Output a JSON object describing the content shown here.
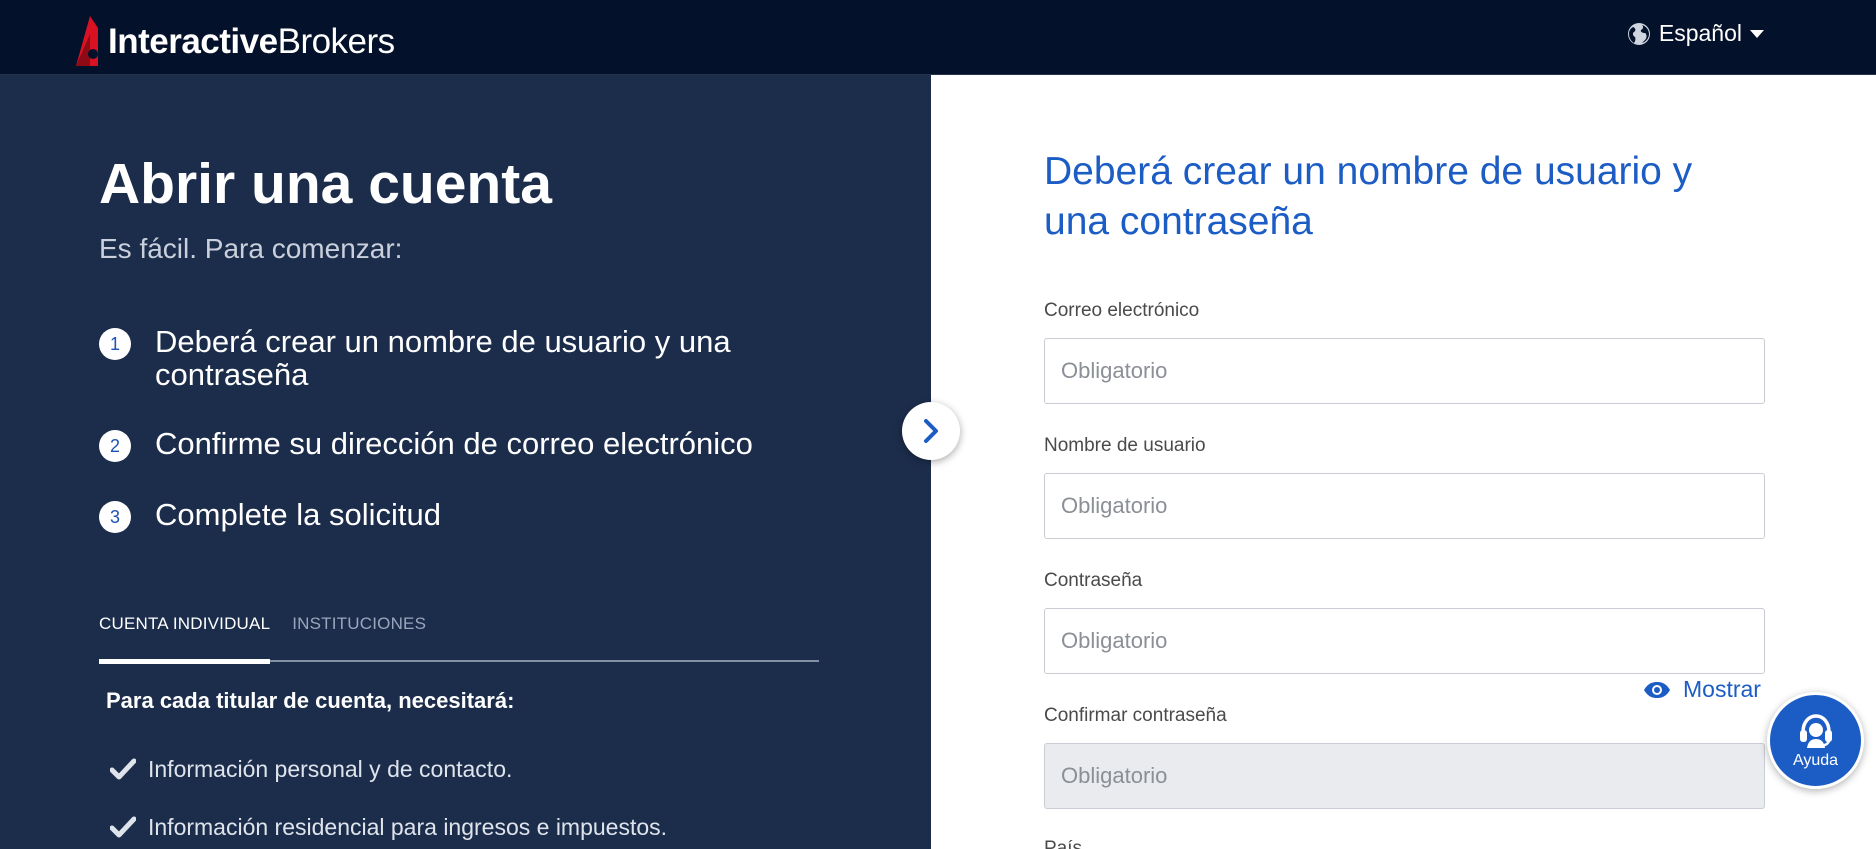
{
  "header": {
    "logo_bold": "Interactive",
    "logo_regular": "Brokers",
    "language": "Español",
    "colors": {
      "bar": "#04112a",
      "logo_red": "#d81222"
    }
  },
  "left": {
    "title": "Abrir una cuenta",
    "subtitle": "Es fácil. Para comenzar:",
    "steps": [
      {
        "num": "1",
        "text": "Deberá crear un nombre de usuario y una contraseña"
      },
      {
        "num": "2",
        "text": "Confirme su dirección de correo electrónico"
      },
      {
        "num": "3",
        "text": "Complete la solicitud"
      }
    ],
    "tabs": [
      {
        "label": "CUENTA INDIVIDUAL",
        "active": true
      },
      {
        "label": "INSTITUCIONES",
        "active": false
      }
    ],
    "needs_heading": "Para cada titular de cuenta, necesitará:",
    "checklist": [
      "Información personal y de contacto.",
      "Información residencial para ingresos e impuestos."
    ],
    "colors": {
      "panel": "#1c2d4b"
    }
  },
  "form": {
    "title": "Deberá crear un nombre de usuario y una contraseña",
    "email_label": "Correo electrónico",
    "email_placeholder": "Obligatorio",
    "username_label": "Nombre de usuario",
    "username_placeholder": "Obligatorio",
    "password_label": "Contraseña",
    "password_placeholder": "Obligatorio",
    "show_label": "Mostrar",
    "confirm_label": "Confirmar contraseña",
    "confirm_placeholder": "Obligatorio",
    "country_label": "País",
    "colors": {
      "accent": "#1c5cc5"
    }
  },
  "help": {
    "label": "Ayuda"
  }
}
